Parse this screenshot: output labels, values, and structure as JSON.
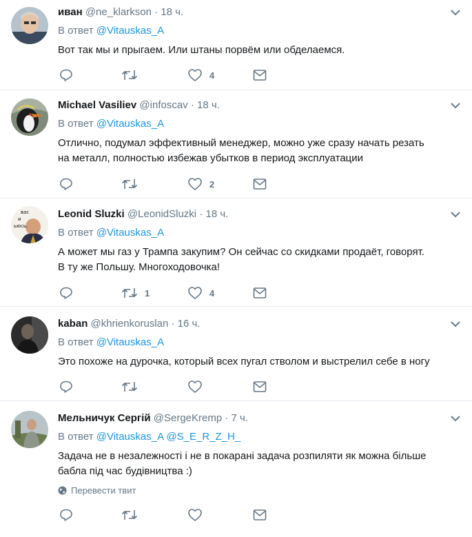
{
  "theme": {
    "accent": "#1b95e0",
    "muted": "#657786",
    "text": "#14171a",
    "divider": "#e6ecf0"
  },
  "icons": {
    "reply": "reply-icon",
    "retweet": "retweet-icon",
    "like": "like-icon",
    "dm": "direct-message-icon",
    "more": "chevron-down-icon",
    "translate": "globe-icon"
  },
  "tweets": [
    {
      "name": "иван",
      "handle": "@ne_klarkson",
      "dot": "·",
      "time": "18 ч.",
      "reply_prefix": "В ответ",
      "mentions": [
        "@Vitauskas_A"
      ],
      "lines": [
        "Вот так мы и прыгаем. Или штаны порвём или обделаемся."
      ],
      "retweets": "",
      "likes": "4"
    },
    {
      "name": "Michael Vasiliev",
      "handle": "@infoscav",
      "dot": "·",
      "time": "18 ч.",
      "reply_prefix": "В ответ",
      "mentions": [
        "@Vitauskas_A"
      ],
      "lines": [
        "Отлично, подумал эффективный менеджер, можно уже сразу начать резать",
        "на металл, полностью избежав убытков в период эксплуатации"
      ],
      "retweets": "",
      "likes": "2"
    },
    {
      "name": "Leonid Sluzki",
      "handle": "@LeonidSluzki",
      "dot": "·",
      "time": "18 ч.",
      "reply_prefix": "В ответ",
      "mentions": [
        "@Vitauskas_A"
      ],
      "lines": [
        "А может мы газ у Трампа закупим? Он сейчас со скидками продаёт, говорят.",
        "В ту же Польшу. Многоходовочка!"
      ],
      "retweets": "1",
      "likes": "4",
      "avatar_caption": [
        "вас",
        "и",
        "ьюсь."
      ]
    },
    {
      "name": "kaban",
      "handle": "@khrienkoruslan",
      "dot": "·",
      "time": "16 ч.",
      "reply_prefix": "В ответ",
      "mentions": [
        "@Vitauskas_A"
      ],
      "lines": [
        "Это похоже на дурочка, который всех пугал стволом и выстрелил себе в ногу"
      ],
      "retweets": "",
      "likes": ""
    },
    {
      "name": "Мельничук Сергій",
      "handle": "@SergeKremp",
      "dot": "·",
      "time": "7 ч.",
      "reply_prefix": "В ответ",
      "mentions": [
        "@Vitauskas_A",
        "@S_E_R_Z_H_"
      ],
      "lines": [
        "Задача не в незалежності і не в покарані задача розпиляти як можна більше",
        "бабла під час будівництва :)"
      ],
      "translate_label": "Перевести твит",
      "retweets": "",
      "likes": ""
    }
  ]
}
